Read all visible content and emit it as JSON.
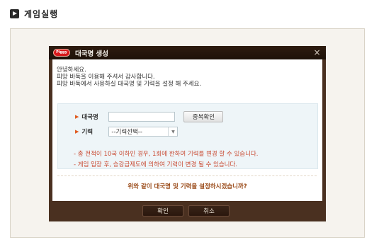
{
  "header": {
    "title": "게임실행"
  },
  "dialog": {
    "logo_text": "Piggy",
    "title": "대국명 생성",
    "close_label": "×",
    "intro": [
      "안녕하세요.",
      "피망 바둑을 이용해 주셔서 감사합니다.",
      "피망 바둑에서 사용하실 대국명 및 기력을 설정 해 주세요."
    ],
    "form": {
      "name_label": "대국명",
      "name_value": "",
      "name_placeholder": "",
      "dup_check_label": "중복확인",
      "flag_label": "기력",
      "flag_value": "--기력선택--"
    },
    "notes": [
      "- 총 전적이 10국 이하인 경우, 1회에 한하여 기력를 변경 할 수 있습니다.",
      "- 게임 입장 후, 승강급제도에 의하여 기력이 변경 될 수 있습니다."
    ],
    "question": "위와 같이 대국명 및 기력을 설정하시겠습니까?",
    "buttons": {
      "ok": "확인",
      "cancel": "취소"
    }
  }
}
